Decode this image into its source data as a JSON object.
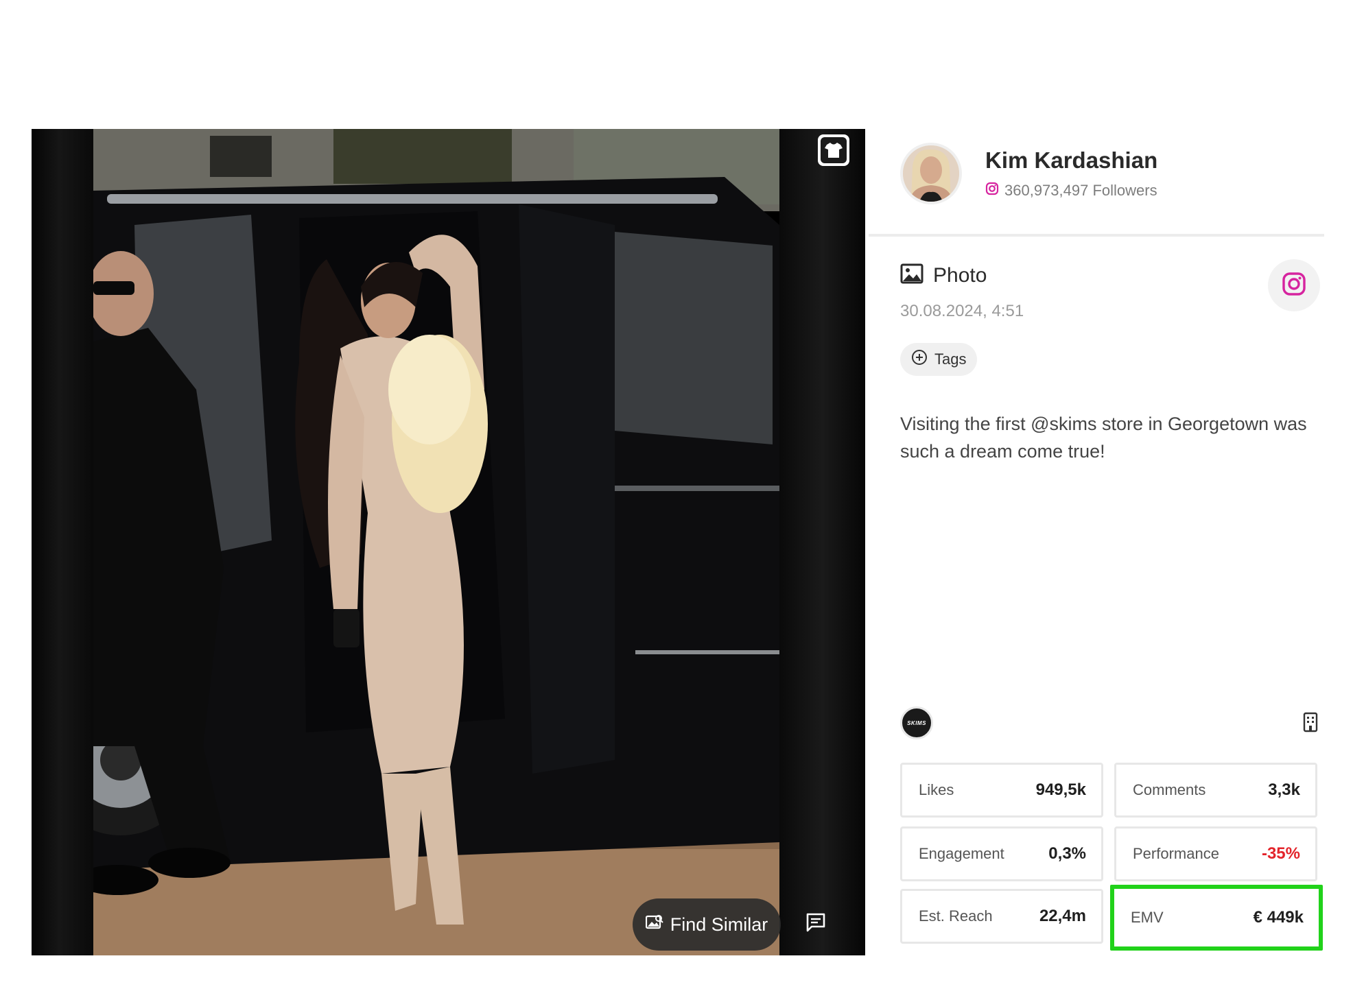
{
  "profile": {
    "name": "Kim Kardashian",
    "followers": "360,973,497 Followers"
  },
  "post": {
    "type": "Photo",
    "date": "30.08.2024, 4:51",
    "tags_label": "Tags",
    "caption": "Visiting the first @skims store in Georgetown was such a dream come true!"
  },
  "media": {
    "find_similar_label": "Find Similar"
  },
  "brand": {
    "logo_text": "SKIMS"
  },
  "stats": {
    "likes": {
      "label": "Likes",
      "value": "949,5k"
    },
    "comments": {
      "label": "Comments",
      "value": "3,3k"
    },
    "engagement": {
      "label": "Engagement",
      "value": "0,3%"
    },
    "performance": {
      "label": "Performance",
      "value": "-35%"
    },
    "reach": {
      "label": "Est. Reach",
      "value": "22,4m"
    },
    "emv": {
      "label": "EMV",
      "value": "€ 449k"
    }
  },
  "colors": {
    "instagram": "#d6249f",
    "negative": "#e3242b",
    "highlight": "#21d21a"
  }
}
